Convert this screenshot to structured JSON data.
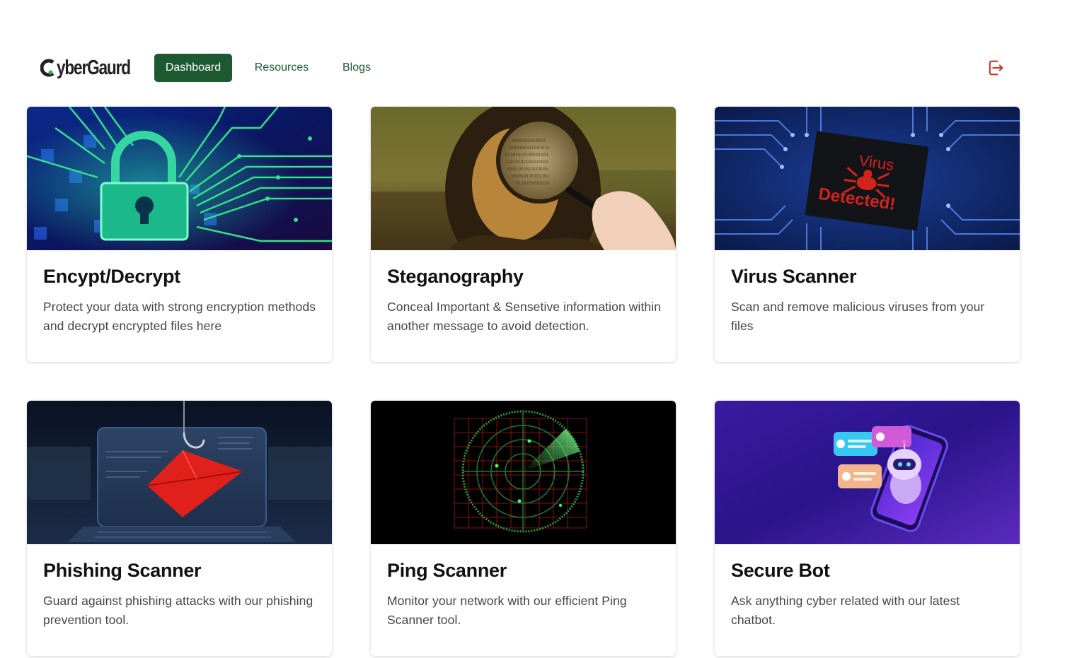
{
  "brand": {
    "logo_text": "yberGaurd"
  },
  "nav": {
    "dashboard_label": "Dashboard",
    "resources_label": "Resources",
    "blogs_label": "Blogs",
    "logout_icon": "logout-icon",
    "accent": "#1d5a31"
  },
  "cards": [
    {
      "title": "Encypt/Decrypt",
      "description": "Protect your data with strong encryption methods and decrypt encrypted files here",
      "image": "padlock-circuit"
    },
    {
      "title": "Steganography",
      "description": "Conceal Important & Sensetive information within another message to avoid detection.",
      "image": "mona-lisa-magnifier"
    },
    {
      "title": "Virus Scanner",
      "description": "Scan and remove malicious viruses from your files",
      "image": "virus-detected-circuit",
      "image_text": {
        "line1": "Virus",
        "line2": "Detected!"
      }
    },
    {
      "title": "Phishing Scanner",
      "description": "Guard against phishing attacks with our phishing prevention tool.",
      "image": "phishing-hook-envelope"
    },
    {
      "title": "Ping Scanner",
      "description": "Monitor your network with our efficient Ping Scanner tool.",
      "image": "radar-screen"
    },
    {
      "title": "Secure Bot",
      "description": "Ask anything cyber related with our latest chatbot.",
      "image": "robot-phone-chat"
    }
  ]
}
